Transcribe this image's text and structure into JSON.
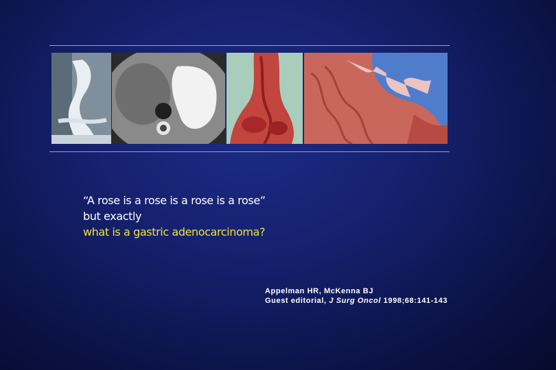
{
  "quote": {
    "line1": "“A rose is a rose is a rose is a rose”",
    "line2": "but exactly",
    "line3": "what is a gastric adenocarcinoma?"
  },
  "citation": {
    "authors": "Appelman HR, McKenna BJ",
    "prefix": "Guest editorial, ",
    "journal": "J Surg Oncol",
    "details": " 1998;68:141-143"
  },
  "colors": {
    "text": "#ffffff",
    "highlight": "#f0e23a",
    "background": "#15206c"
  }
}
